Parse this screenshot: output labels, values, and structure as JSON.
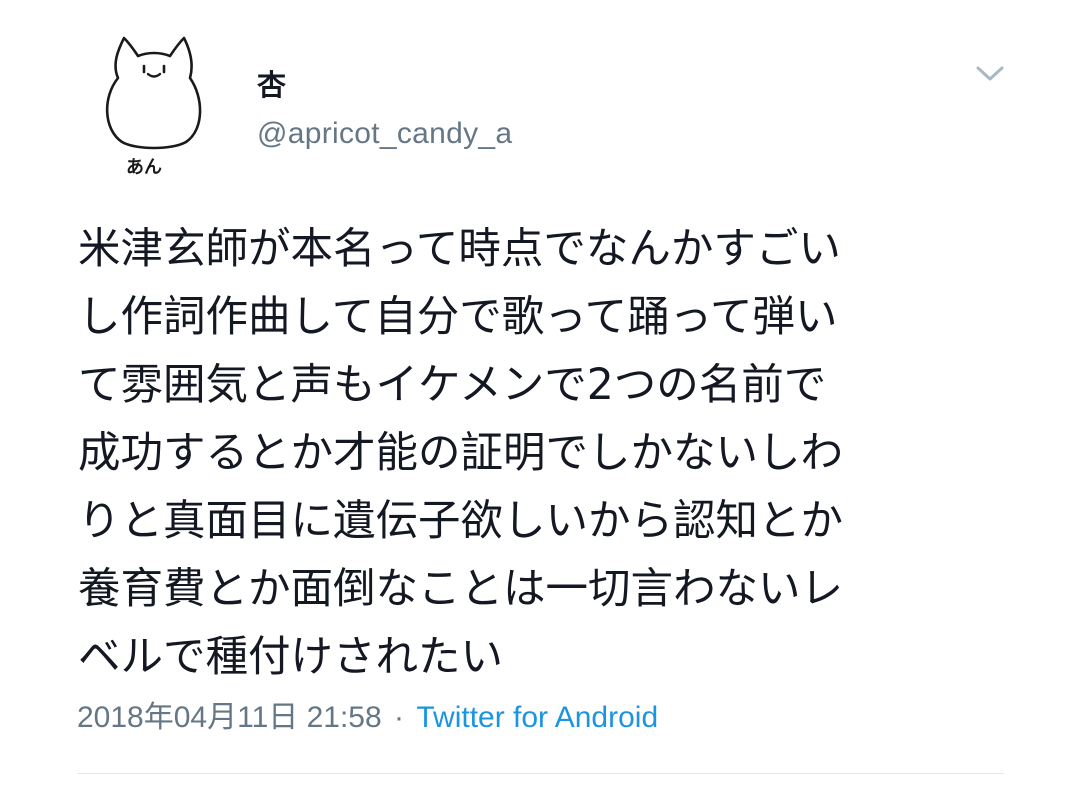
{
  "tweet": {
    "author": {
      "display_name": "杏",
      "handle": "@apricot_candy_a",
      "avatar_caption": "あん"
    },
    "text": "米津玄師が本名って時点でなんかすごい\nし作詞作曲して自分で歌って踊って弾い\nて雰囲気と声もイケメンで2つの名前で\n成功するとか才能の証明でしかないしわ\nりと真面目に遺伝子欲しいから認知とか\n養育費とか面倒なことは一切言わないレ\nベルで種付けされたい",
    "timestamp": "2018年04月11日 21:58",
    "separator": "·",
    "source": "Twitter for Android"
  },
  "icons": {
    "avatar": "cat-doodle-avatar",
    "menu": "chevron-down-icon"
  },
  "colors": {
    "text": "#141823",
    "muted": "#657786",
    "link": "#1b95e0",
    "divider": "#e1e8ed"
  }
}
